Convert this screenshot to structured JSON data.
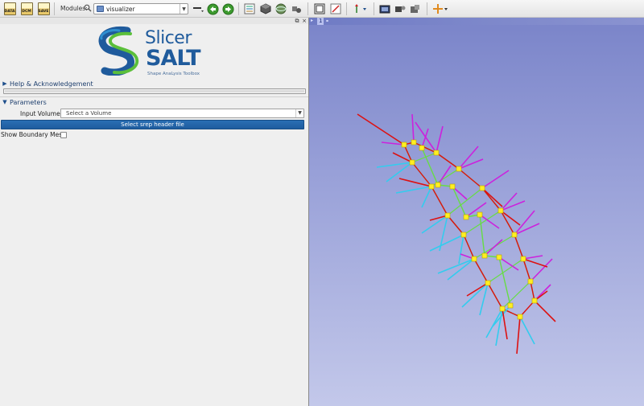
{
  "toolbar": {
    "file_buttons": [
      {
        "name": "data-button",
        "label": "DATA"
      },
      {
        "name": "dcm-button",
        "label": "DCM"
      },
      {
        "name": "save-button",
        "label": "SAVE"
      }
    ],
    "modules_label": "Modules:",
    "module_selected": "visualizer"
  },
  "panel": {
    "logo": {
      "line1": "Slicer",
      "line2": "SALT",
      "tagline": "Shape AnaLysis Toolbox",
      "colors": {
        "blue": "#1f5b9c",
        "green": "#5bbf3a"
      }
    },
    "help_section": "Help & Acknowledgement",
    "parameters_section": "Parameters",
    "input_volume_label": "Input Volume:",
    "input_volume_value": "Select a Volume",
    "srep_button": "Select srep header file",
    "boundary_mesh_label": "Show Boundary Mesh",
    "boundary_mesh_checked": false
  },
  "view3d": {
    "label": "1",
    "colors": {
      "background_top": "#7a84c9",
      "background_bottom": "#c3c8ea",
      "spoke_up": "#cc22dd",
      "spoke_down": "#33ccee",
      "spoke_crest": "#dd1111",
      "skeleton": "#66dd44",
      "atom": "#ffee22"
    }
  }
}
